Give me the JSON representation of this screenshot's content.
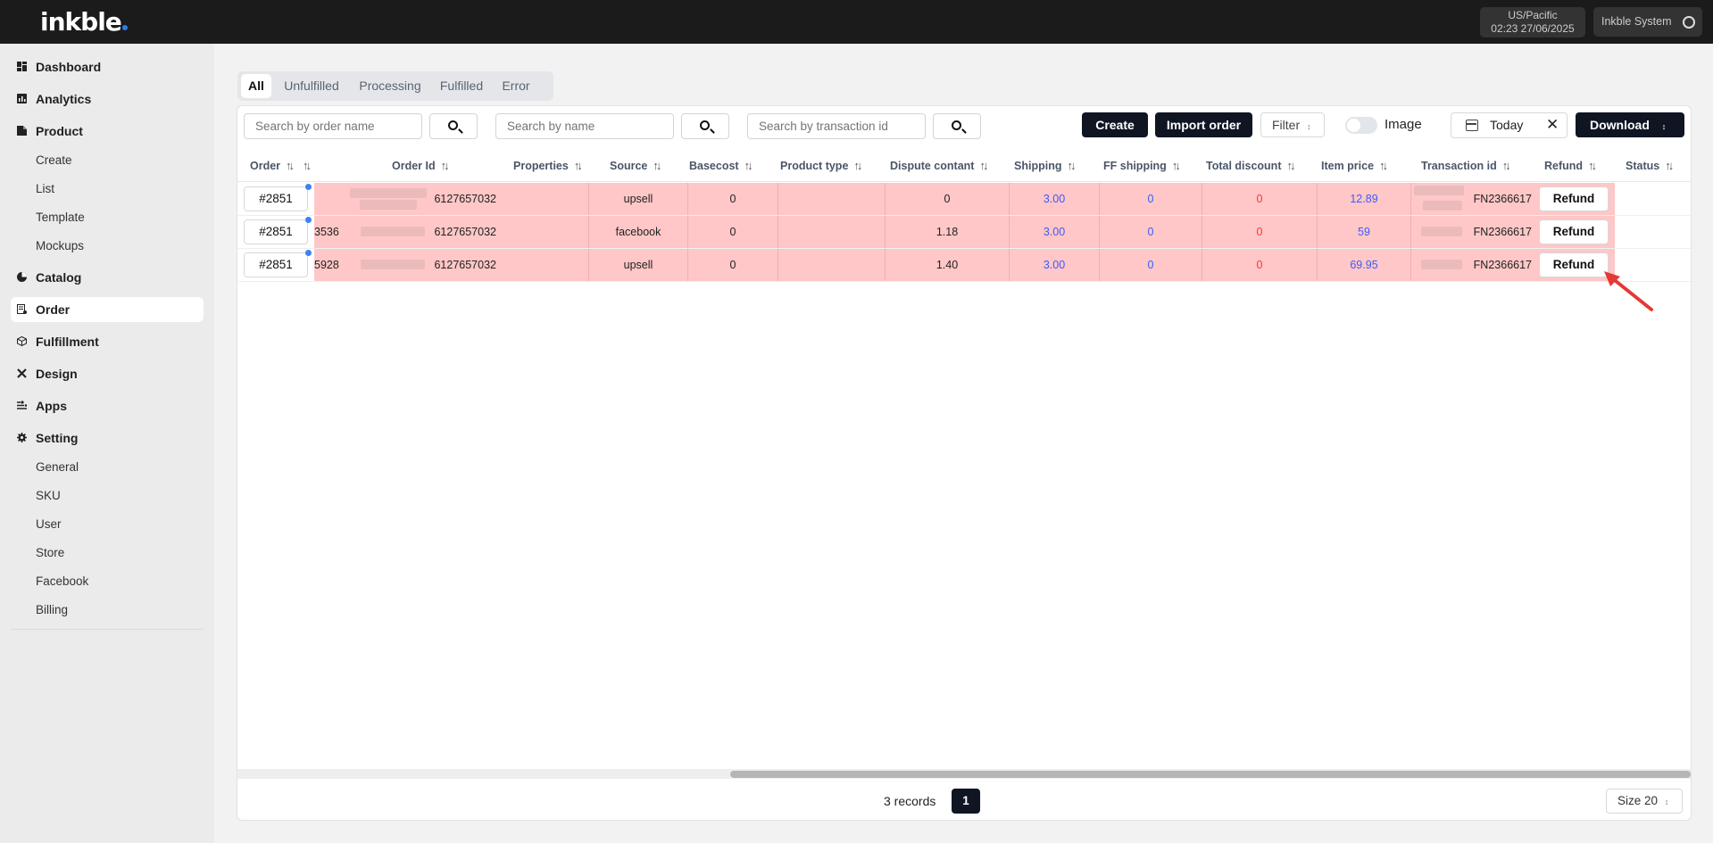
{
  "header": {
    "logo": "inkble",
    "timezone": "US/Pacific",
    "datetime": "02:23 27/06/2025",
    "user": "Inkble System"
  },
  "sidebar": {
    "items": [
      {
        "label": "Dashboard",
        "icon": "dashboard-icon"
      },
      {
        "label": "Analytics",
        "icon": "analytics-icon"
      },
      {
        "label": "Product",
        "icon": "product-icon",
        "children": [
          "Create",
          "List",
          "Template",
          "Mockups"
        ]
      },
      {
        "label": "Catalog",
        "icon": "catalog-icon"
      },
      {
        "label": "Order",
        "icon": "order-icon",
        "active": true
      },
      {
        "label": "Fulfillment",
        "icon": "fulfillment-icon"
      },
      {
        "label": "Design",
        "icon": "design-icon"
      },
      {
        "label": "Apps",
        "icon": "apps-icon"
      },
      {
        "label": "Setting",
        "icon": "gear-icon",
        "children": [
          "General",
          "SKU",
          "User",
          "Store",
          "Facebook",
          "Billing"
        ]
      }
    ]
  },
  "tabs": [
    "All",
    "Unfulfilled",
    "Processing",
    "Fulfilled",
    "Error"
  ],
  "active_tab": "All",
  "toolbar": {
    "search_order_placeholder": "Search by order name",
    "search_name_placeholder": "Search by name",
    "search_txn_placeholder": "Search by transaction id",
    "create": "Create",
    "import": "Import order",
    "filter": "Filter",
    "image_toggle": "Image",
    "date": "Today",
    "download": "Download"
  },
  "table": {
    "columns": [
      "Order",
      "Order Id",
      "Properties",
      "Source",
      "Basecost",
      "Product type",
      "Dispute contant",
      "Shipping",
      "FF shipping",
      "Total discount",
      "Item price",
      "Transaction id",
      "Refund",
      "Status"
    ],
    "rows": [
      {
        "order": "#2851",
        "partial": "",
        "order_id": "6127657032",
        "properties": "",
        "source": "upsell",
        "basecost": "0",
        "product_type": "",
        "dispute": "0",
        "shipping": "3.00",
        "ff_shipping": "0",
        "total_discount": "0",
        "item_price": "12.89",
        "transaction_id": "FN2366617",
        "refund": "Refund",
        "status": ""
      },
      {
        "order": "#2851",
        "partial": "3536",
        "order_id": "6127657032",
        "properties": "",
        "source": "facebook",
        "basecost": "0",
        "product_type": "",
        "dispute": "1.18",
        "shipping": "3.00",
        "ff_shipping": "0",
        "total_discount": "0",
        "item_price": "59",
        "transaction_id": "FN2366617",
        "refund": "Refund",
        "status": ""
      },
      {
        "order": "#2851",
        "partial": "5928",
        "order_id": "6127657032",
        "properties": "",
        "source": "upsell",
        "basecost": "0",
        "product_type": "",
        "dispute": "1.40",
        "shipping": "3.00",
        "ff_shipping": "0",
        "total_discount": "0",
        "item_price": "69.95",
        "transaction_id": "FN2366617",
        "refund": "Refund",
        "status": ""
      }
    ]
  },
  "footer": {
    "records": "3 records",
    "page": "1",
    "size": "Size 20"
  },
  "colors": {
    "row_highlight": "#ffc7c7",
    "accent_dark": "#0f1523",
    "blue_value": "#3b5bff",
    "red_value": "#ff3333",
    "annotation_arrow": "#e53935"
  }
}
